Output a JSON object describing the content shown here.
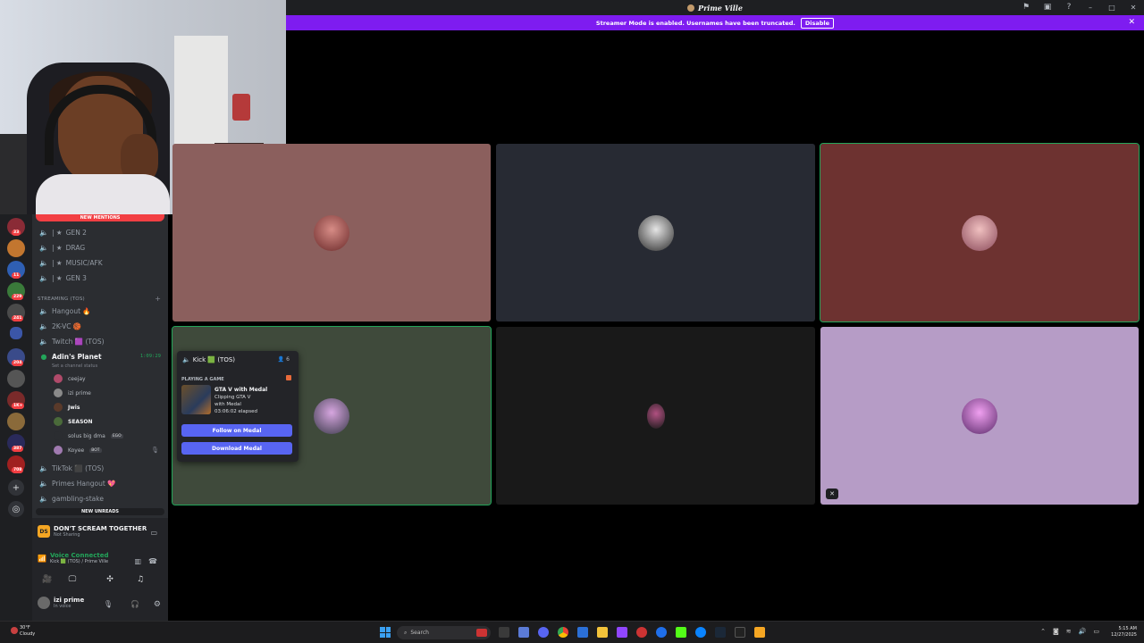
{
  "window": {
    "title": "Prime Ville"
  },
  "banner": {
    "text": "Streamer Mode is enabled. Usernames have been truncated.",
    "disable_label": "Disable"
  },
  "sidebar": {
    "new_mentions": "NEW MENTIONS",
    "new_unreads": "NEW UNREADS",
    "channels_top": [
      {
        "label": "GEN 2"
      },
      {
        "label": "DRAG"
      },
      {
        "label": "MUSIC/AFK"
      },
      {
        "label": "GEN 3"
      }
    ],
    "category": "STREAMING (TOS)",
    "channels_mid": [
      {
        "label": "Hangout 🔥"
      },
      {
        "label": "2K-VC 🏀"
      },
      {
        "label": "Twitch 🟪 (TOS)"
      }
    ],
    "active_channel": {
      "label": "Adin's Planet",
      "timer": "1:09:29",
      "status": "Set a channel status"
    },
    "voice_users": [
      {
        "name": "ceejay"
      },
      {
        "name": "izi prime"
      },
      {
        "name": "Jwis"
      },
      {
        "name": "SEASON"
      },
      {
        "name": "solus big dma",
        "tag": "EGO"
      },
      {
        "name": "Koyee",
        "tag": "BOT"
      }
    ],
    "channels_bottom": [
      {
        "label": "TikTok ⬛ (TOS)"
      },
      {
        "label": "Primes Hangout 💖"
      },
      {
        "label": "gambling-stake"
      }
    ],
    "server_badges": [
      "33",
      "11",
      "229",
      "241",
      "204",
      "1K+",
      "387",
      "708"
    ]
  },
  "activity": {
    "game_title": "DON'T SCREAM TOGETHER",
    "game_sub": "Not Sharing",
    "voice_status": "Voice Connected",
    "voice_location": "Kick 🟩 (TOS) / Prime Ville",
    "user_name": "izi prime",
    "user_status": "In voice"
  },
  "popout": {
    "channel": "Kick 🟩 (TOS)",
    "count": "6",
    "label": "PLAYING A GAME",
    "game": "GTA V with Medal",
    "detail_1": "Clipping GTA V",
    "detail_2": "with Medal",
    "elapsed": "03:06:02 elapsed",
    "follow_btn": "Follow on Medal",
    "download_btn": "Download Medal"
  },
  "taskbar": {
    "weather_temp": "30°F",
    "weather_desc": "Cloudy",
    "search_placeholder": "Search",
    "time": "5:15 AM",
    "date": "12/27/2025"
  },
  "colors": {
    "accent": "#5865f2",
    "banner": "#7e1cf0",
    "speaking": "#23a55a",
    "mention": "#f23f43"
  }
}
